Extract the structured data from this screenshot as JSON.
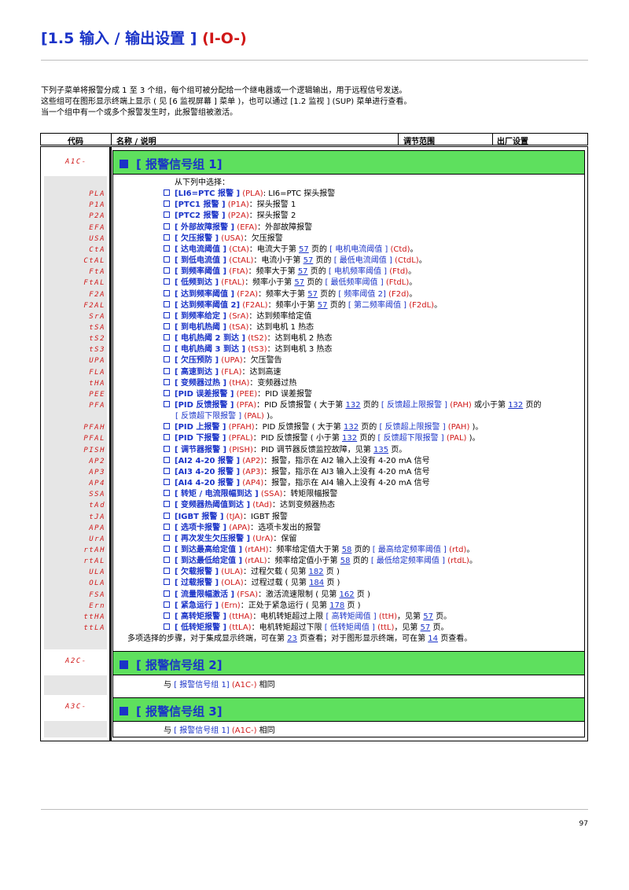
{
  "header": {
    "title_main": "[1.5 输入 / 输出设置 ]",
    "title_code": "(I-O-)"
  },
  "intro": [
    "下列子菜单将报警分成 1 至 3 个组，每个组可被分配给一个继电器或一个逻辑输出，用于远程信号发送。",
    "这些组可在图形显示终端上显示 ( 见 [6 监视屏幕 ] 菜单 )，也可以通过 [1.2 监视 ] (SUP) 菜单进行查看。",
    "当一个组中有一个或多个报警发生时，此报警组被激活。"
  ],
  "table_header": {
    "code": "代码",
    "name": "名称 / 说明",
    "range": "调节范围",
    "factory": "出厂设置"
  },
  "group1": {
    "code": "A1C-",
    "title": "[ 报警信号组 1]"
  },
  "choose": "从下列中选择：",
  "items": [
    {
      "code": "PLA",
      "name": "[LI6=PTC 报警 ]",
      "sym": "(PLA)",
      "desc": [
        {
          "t": ": LI6=PTC 探头报警"
        }
      ]
    },
    {
      "code": "P1A",
      "name": "[PTC1 报警 ]",
      "sym": "(P1A)",
      "desc": [
        {
          "t": "：探头报警 1"
        }
      ]
    },
    {
      "code": "P2A",
      "name": "[PTC2 报警 ]",
      "sym": "(P2A)",
      "desc": [
        {
          "t": "：探头报警 2"
        }
      ]
    },
    {
      "code": "EFA",
      "name": "[ 外部故障报警 ]",
      "sym": "(EFA)",
      "desc": [
        {
          "t": "：外部故障报警"
        }
      ]
    },
    {
      "code": "USA",
      "name": "[ 欠压报警 ]",
      "sym": "(USA)",
      "desc": [
        {
          "t": "：欠压报警"
        }
      ]
    },
    {
      "code": "CtA",
      "name": "[ 达电流阈值 ]",
      "sym": "(CtA)",
      "desc": [
        {
          "t": "：电流大于第 "
        },
        {
          "t": "57",
          "k": "pg"
        },
        {
          "t": " 页的 "
        },
        {
          "t": "[ 电机电流阈值 ]",
          "k": "n"
        },
        {
          "t": " (Ctd)",
          "k": "c"
        },
        {
          "t": "。"
        }
      ]
    },
    {
      "code": "CtAL",
      "name": "[ 到低电流值 ]",
      "sym": "(CtAL)",
      "desc": [
        {
          "t": "：电流小于第 "
        },
        {
          "t": "57",
          "k": "pg"
        },
        {
          "t": " 页的 "
        },
        {
          "t": "[ 最低电流阈值 ]",
          "k": "n"
        },
        {
          "t": " (CtdL)",
          "k": "c"
        },
        {
          "t": "。"
        }
      ]
    },
    {
      "code": "FtA",
      "name": "[ 到频率阈值 ]",
      "sym": "(FtA)",
      "desc": [
        {
          "t": "：频率大于第 "
        },
        {
          "t": "57",
          "k": "pg"
        },
        {
          "t": " 页的 "
        },
        {
          "t": "[ 电机频率阈值 ]",
          "k": "n"
        },
        {
          "t": " (Ftd)",
          "k": "c"
        },
        {
          "t": "。"
        }
      ]
    },
    {
      "code": "FtAL",
      "name": "[ 低频到达 ]",
      "sym": "(FtAL)",
      "desc": [
        {
          "t": "：频率小于第 "
        },
        {
          "t": "57",
          "k": "pg"
        },
        {
          "t": " 页的 "
        },
        {
          "t": "[ 最低频率阈值 ]",
          "k": "n"
        },
        {
          "t": " (FtdL)",
          "k": "c"
        },
        {
          "t": "。"
        }
      ]
    },
    {
      "code": "F2A",
      "name": "[ 达到频率阈值 ]",
      "sym": "(F2A)",
      "desc": [
        {
          "t": "：频率大于第 "
        },
        {
          "t": "57",
          "k": "pg"
        },
        {
          "t": " 页的 "
        },
        {
          "t": "[ 频率阈值 2]",
          "k": "n"
        },
        {
          "t": " (F2d)",
          "k": "c"
        },
        {
          "t": "。"
        }
      ]
    },
    {
      "code": "F2AL",
      "name": "[ 达到频率阈值 2]",
      "sym": "(F2AL)",
      "desc": [
        {
          "t": "：频率小于第 "
        },
        {
          "t": "57",
          "k": "pg"
        },
        {
          "t": " 页的 "
        },
        {
          "t": "[ 第二频率阈值 ]",
          "k": "n"
        },
        {
          "t": " (F2dL)",
          "k": "c"
        },
        {
          "t": "。"
        }
      ]
    },
    {
      "code": "SrA",
      "name": "[ 到频率给定 ]",
      "sym": "(SrA)",
      "desc": [
        {
          "t": "：达到频率给定值"
        }
      ]
    },
    {
      "code": "tSA",
      "name": "[ 到电机热阈 ]",
      "sym": "(tSA)",
      "desc": [
        {
          "t": "：达到电机 1 热态"
        }
      ]
    },
    {
      "code": "tS2",
      "name": "[ 电机热阈 2 到达 ]",
      "sym": "(tS2)",
      "desc": [
        {
          "t": "：达到电机 2 热态"
        }
      ]
    },
    {
      "code": "tS3",
      "name": "[ 电机热阈 3 到达 ]",
      "sym": "(tS3)",
      "desc": [
        {
          "t": "：达到电机 3 热态"
        }
      ]
    },
    {
      "code": "UPA",
      "name": "[ 欠压预防 ]",
      "sym": "(UPA)",
      "desc": [
        {
          "t": "：欠压警告"
        }
      ]
    },
    {
      "code": "FLA",
      "name": "[ 高速到达 ]",
      "sym": "(FLA)",
      "desc": [
        {
          "t": "：达到高速"
        }
      ]
    },
    {
      "code": "tHA",
      "name": "[ 变频器过热 ]",
      "sym": "(tHA)",
      "desc": [
        {
          "t": "：变频器过热"
        }
      ]
    },
    {
      "code": "PEE",
      "name": "[PID 误差报警 ]",
      "sym": "(PEE)",
      "desc": [
        {
          "t": "：PID 误差报警"
        }
      ]
    },
    {
      "code": "PFA",
      "name": "[PID 反馈报警 ]",
      "sym": "(PFA)",
      "desc": [
        {
          "t": "：PID 反馈报警 ( 大于第 "
        },
        {
          "t": "132",
          "k": "pg"
        },
        {
          "t": " 页的 "
        },
        {
          "t": "[ 反馈超上限报警 ]",
          "k": "n"
        },
        {
          "t": " (PAH)",
          "k": "c"
        },
        {
          "t": " 或小于第 "
        },
        {
          "t": "132",
          "k": "pg"
        },
        {
          "t": " 页的"
        }
      ]
    },
    {
      "code": "",
      "cont": true,
      "desc": [
        {
          "t": "[ 反馈超下限报警 ]",
          "k": "n"
        },
        {
          "t": " (PAL)",
          "k": "c"
        },
        {
          "t": " )。"
        }
      ]
    },
    {
      "code": "PFAH",
      "name": "[PID 上报警 ]",
      "sym": "(PFAH)",
      "desc": [
        {
          "t": "：PID 反馈报警 ( 大于第 "
        },
        {
          "t": "132",
          "k": "pg"
        },
        {
          "t": " 页的 "
        },
        {
          "t": "[ 反馈超上限报警 ]",
          "k": "n"
        },
        {
          "t": " (PAH)",
          "k": "c"
        },
        {
          "t": " )。"
        }
      ]
    },
    {
      "code": "PFAL",
      "name": "[PID 下报警 ]",
      "sym": "(PFAL)",
      "desc": [
        {
          "t": "：PID 反馈报警 ( 小于第 "
        },
        {
          "t": "132",
          "k": "pg"
        },
        {
          "t": " 页的 "
        },
        {
          "t": "[ 反馈超下限报警 ]",
          "k": "n"
        },
        {
          "t": " (PAL)",
          "k": "c"
        },
        {
          "t": " )。"
        }
      ]
    },
    {
      "code": "PISH",
      "name": "[ 调节器报警 ]",
      "sym": "(PISH)",
      "desc": [
        {
          "t": "：PID 调节器反馈监控故障，见第 "
        },
        {
          "t": "135",
          "k": "pg"
        },
        {
          "t": " 页。"
        }
      ]
    },
    {
      "code": "AP2",
      "name": "[AI2 4-20 报警 ]",
      "sym": "(AP2)",
      "desc": [
        {
          "t": "：报警，指示在 AI2 输入上没有 4-20 mA 信号"
        }
      ]
    },
    {
      "code": "AP3",
      "name": "[AI3 4-20 报警 ]",
      "sym": "(AP3)",
      "desc": [
        {
          "t": "：报警，指示在 AI3 输入上没有 4-20 mA 信号"
        }
      ]
    },
    {
      "code": "AP4",
      "name": "[AI4 4-20 报警 ]",
      "sym": "(AP4)",
      "desc": [
        {
          "t": "：报警，指示在 AI4 输入上没有 4-20 mA 信号"
        }
      ]
    },
    {
      "code": "SSA",
      "name": "[ 转矩 / 电流限幅到达 ]",
      "sym": "(SSA)",
      "desc": [
        {
          "t": "：转矩限幅报警"
        }
      ]
    },
    {
      "code": "tAd",
      "name": "[ 变频器热阈值到达 ]",
      "sym": "(tAd)",
      "desc": [
        {
          "t": "：达到变频器热态"
        }
      ]
    },
    {
      "code": "tJA",
      "name": "[IGBT 报警 ]",
      "sym": "(tJA)",
      "desc": [
        {
          "t": "：IGBT 报警"
        }
      ]
    },
    {
      "code": "APA",
      "name": "[ 选项卡报警 ]",
      "sym": "(APA)",
      "desc": [
        {
          "t": "：选项卡发出的报警"
        }
      ]
    },
    {
      "code": "UrA",
      "name": "[ 再次发生欠压报警 ]",
      "sym": "(UrA)",
      "desc": [
        {
          "t": "：保留"
        }
      ]
    },
    {
      "code": "rtAH",
      "name": "[ 到达最高给定值 ]",
      "sym": "(rtAH)",
      "desc": [
        {
          "t": "：频率给定值大于第 "
        },
        {
          "t": "58",
          "k": "pg"
        },
        {
          "t": " 页的 "
        },
        {
          "t": "[ 最高给定频率阈值 ]",
          "k": "n"
        },
        {
          "t": " (rtd)",
          "k": "c"
        },
        {
          "t": "。"
        }
      ]
    },
    {
      "code": "rtAL",
      "name": "[ 到达最低给定值 ]",
      "sym": "(rtAL)",
      "desc": [
        {
          "t": "：频率给定值小于第 "
        },
        {
          "t": "58",
          "k": "pg"
        },
        {
          "t": " 页的 "
        },
        {
          "t": "[ 最低给定频率阈值 ]",
          "k": "n"
        },
        {
          "t": " (rtdL)",
          "k": "c"
        },
        {
          "t": "。"
        }
      ]
    },
    {
      "code": "ULA",
      "name": "[ 欠载报警 ]",
      "sym": "(ULA)",
      "desc": [
        {
          "t": "：过程欠载 ( 见第 "
        },
        {
          "t": "182",
          "k": "pg"
        },
        {
          "t": " 页 )"
        }
      ]
    },
    {
      "code": "OLA",
      "name": "[ 过载报警 ]",
      "sym": "(OLA)",
      "desc": [
        {
          "t": "：过程过载 ( 见第 "
        },
        {
          "t": "184",
          "k": "pg"
        },
        {
          "t": " 页 )"
        }
      ]
    },
    {
      "code": "FSA",
      "name": "[ 流量限幅激活 ]",
      "sym": "(FSA)",
      "desc": [
        {
          "t": "：激活流速限制 ( 见第 "
        },
        {
          "t": "162",
          "k": "pg"
        },
        {
          "t": " 页 )"
        }
      ]
    },
    {
      "code": "Ern",
      "name": "[ 紧急运行 ]",
      "sym": "(Ern)",
      "desc": [
        {
          "t": "：正处于紧急运行 ( 见第 "
        },
        {
          "t": "178",
          "k": "pg"
        },
        {
          "t": " 页 )"
        }
      ]
    },
    {
      "code": "ttHA",
      "name": "[ 高转矩报警 ]",
      "sym": "(ttHA)",
      "desc": [
        {
          "t": "：电机转矩超过上限 "
        },
        {
          "t": "[ 高转矩阈值 ]",
          "k": "n"
        },
        {
          "t": " (ttH)",
          "k": "c"
        },
        {
          "t": "，见第 "
        },
        {
          "t": "57",
          "k": "pg"
        },
        {
          "t": " 页。"
        }
      ]
    },
    {
      "code": "ttLA",
      "name": "[ 低转矩报警 ]",
      "sym": "(ttLA)",
      "desc": [
        {
          "t": "：电机转矩超过下限 "
        },
        {
          "t": "[ 低转矩阈值 ]",
          "k": "n"
        },
        {
          "t": " (ttL)",
          "k": "c"
        },
        {
          "t": "，见第 "
        },
        {
          "t": "57",
          "k": "pg"
        },
        {
          "t": " 页。"
        }
      ]
    }
  ],
  "footer_note": [
    {
      "t": "多项选择的步骤，对于集成显示终端，可在第 "
    },
    {
      "t": "23",
      "k": "pg"
    },
    {
      "t": " 页查看；对于图形显示终端，可在第 "
    },
    {
      "t": "14",
      "k": "pg"
    },
    {
      "t": " 页查看。"
    }
  ],
  "group2": {
    "code": "A2C-",
    "title": "[ 报警信号组 2]",
    "same_prefix": "与 ",
    "same_link": "[ 报警信号组 1]",
    "same_code": " (A1C-)",
    "same_suffix": " 相同"
  },
  "group3": {
    "code": "A3C-",
    "title": "[ 报警信号组 3]",
    "same_prefix": "与 ",
    "same_link": "[ 报警信号组 1]",
    "same_code": " (A1C-)",
    "same_suffix": " 相同"
  },
  "page_number": "97",
  "colors": {
    "blue": "#1a33c8",
    "red": "#d01818",
    "green": "#5ee05e",
    "code_bg": "#e6e6e6"
  }
}
